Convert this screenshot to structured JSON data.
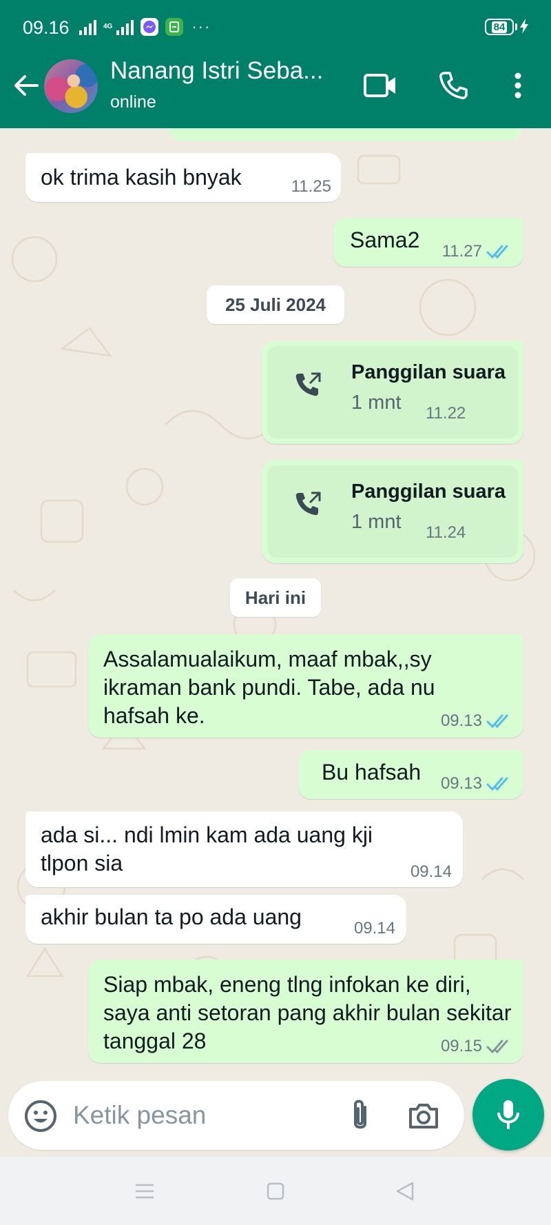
{
  "status_bar": {
    "time": "09.16",
    "network_label": "4G",
    "battery": "84",
    "app_icons": [
      "messenger-icon",
      "notification-app-icon"
    ],
    "overflow": "···"
  },
  "header": {
    "contact_name": "Nanang Istri Seba...",
    "contact_status": "online",
    "icons": [
      "back-arrow-icon",
      "video-call-icon",
      "phone-icon",
      "more-vert-icon"
    ]
  },
  "colors": {
    "header": "#008069",
    "incoming_bubble": "#ffffff",
    "outgoing_bubble": "#d9fdd3",
    "read_tick": "#53bdeb",
    "sent_tick": "#8696a0",
    "mic_button": "#00a884",
    "chat_bg": "#efeae2"
  },
  "chat": {
    "msg1": {
      "text": "ok trima kasih bnyak",
      "time": "11.25",
      "direction": "in"
    },
    "msg2": {
      "text": "Sama2",
      "time": "11.27",
      "direction": "out",
      "status": "read"
    },
    "date1": "25 Juli 2024",
    "call1": {
      "title": "Panggilan suara",
      "duration": "1 mnt",
      "time": "11.22",
      "icon": "outgoing-call-icon"
    },
    "call2": {
      "title": "Panggilan suara",
      "duration": "1 mnt",
      "time": "11.24",
      "icon": "outgoing-call-icon"
    },
    "date2": "Hari ini",
    "msg3": {
      "text": "Assalamualaikum, maaf mbak,,sy ikraman bank pundi. Tabe, ada nu hafsah ke.",
      "time": "09.13",
      "direction": "out",
      "status": "read"
    },
    "msg4": {
      "text": "Bu hafsah",
      "time": "09.13",
      "direction": "out",
      "status": "read"
    },
    "msg5": {
      "text": "ada si... ndi lmin kam ada uang kji tlpon sia",
      "time": "09.14",
      "direction": "in"
    },
    "msg6": {
      "text": "akhir bulan ta po ada uang",
      "time": "09.14",
      "direction": "in"
    },
    "msg7": {
      "text": "Siap mbak, eneng tlng infokan ke diri, saya anti setoran pang akhir bulan sekitar tanggal 28",
      "time": "09.15",
      "direction": "out",
      "status": "delivered"
    }
  },
  "input": {
    "placeholder": "Ketik pesan",
    "icons": [
      "emoji-icon",
      "attach-icon",
      "camera-icon",
      "mic-icon"
    ]
  },
  "navbar": {
    "icons": [
      "menu-icon",
      "home-icon",
      "back-icon"
    ]
  }
}
